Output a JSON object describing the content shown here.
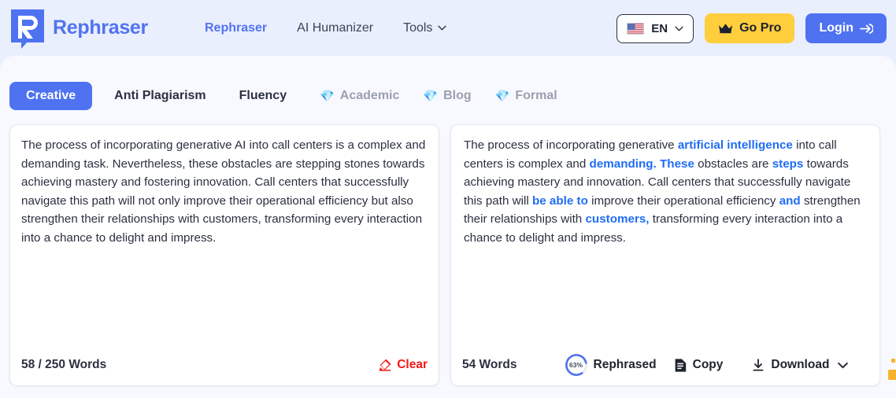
{
  "brand": {
    "name": "Rephraser",
    "logo_icon": "rephraser-logo-icon"
  },
  "nav": {
    "items": [
      {
        "label": "Rephraser",
        "active": true,
        "has_chevron": false
      },
      {
        "label": "AI Humanizer",
        "active": false,
        "has_chevron": false
      },
      {
        "label": "Tools",
        "active": false,
        "has_chevron": true
      }
    ]
  },
  "header_right": {
    "language": {
      "flag": "us-flag-icon",
      "code": "EN",
      "chevron": "chevron-down-icon"
    },
    "go_pro": {
      "label": "Go Pro",
      "icon": "crown-icon",
      "color": "#ffce3c"
    },
    "login": {
      "label": "Login",
      "icon": "login-arrow-icon",
      "color": "#4e72f0"
    }
  },
  "tabs": [
    {
      "label": "Creative",
      "active": true,
      "locked": false
    },
    {
      "label": "Anti Plagiarism",
      "active": false,
      "locked": false
    },
    {
      "label": "Fluency",
      "active": false,
      "locked": false
    },
    {
      "label": "Academic",
      "active": false,
      "locked": true,
      "icon": "gem-icon"
    },
    {
      "label": "Blog",
      "active": false,
      "locked": true,
      "icon": "gem-icon"
    },
    {
      "label": "Formal",
      "active": false,
      "locked": true,
      "icon": "gem-icon"
    }
  ],
  "input_panel": {
    "text": "The process of incorporating generative AI into call centers is a complex and demanding task. Nevertheless, these obstacles are stepping stones towards achieving mastery and fostering innovation. Call centers that successfully navigate this path will not only improve their operational efficiency but also strengthen their relationships with customers, transforming every interaction into a chance to delight and impress.",
    "word_count_label": "58 / 250 Words",
    "clear_label": "Clear",
    "clear_icon": "eraser-icon"
  },
  "output_panel": {
    "segments": [
      {
        "text": " The process of incorporating generative ",
        "highlight": false
      },
      {
        "text": "artificial intelligence",
        "highlight": true
      },
      {
        "text": " into call centers is complex and ",
        "highlight": false
      },
      {
        "text": "demanding.",
        "highlight": true
      },
      {
        "text": "  ",
        "highlight": false
      },
      {
        "text": "These",
        "highlight": true
      },
      {
        "text": " obstacles are ",
        "highlight": false
      },
      {
        "text": "steps",
        "highlight": true
      },
      {
        "text": " towards achieving mastery and innovation.  Call centers that successfully navigate this path will ",
        "highlight": false
      },
      {
        "text": "be able to",
        "highlight": true
      },
      {
        "text": " improve their operational efficiency ",
        "highlight": false
      },
      {
        "text": "and",
        "highlight": true
      },
      {
        "text": " strengthen their relationships with ",
        "highlight": false
      },
      {
        "text": "customers,",
        "highlight": true
      },
      {
        "text": " transforming every interaction into a chance to delight and impress.",
        "highlight": false
      }
    ],
    "word_count_label": "54 Words",
    "progress_percent": "63%",
    "rephrased_label": "Rephrased",
    "copy_label": "Copy",
    "copy_icon": "copy-document-icon",
    "download_label": "Download",
    "download_icon": "download-icon",
    "download_chevron": "chevron-down-icon"
  },
  "colors": {
    "accent_blue": "#4e72f0",
    "highlight_blue": "#1f6df5",
    "pro_yellow": "#ffce3c",
    "clear_red": "#f51616",
    "header_bg": "#e9effd",
    "sheet_bg": "#f7f9ff"
  }
}
